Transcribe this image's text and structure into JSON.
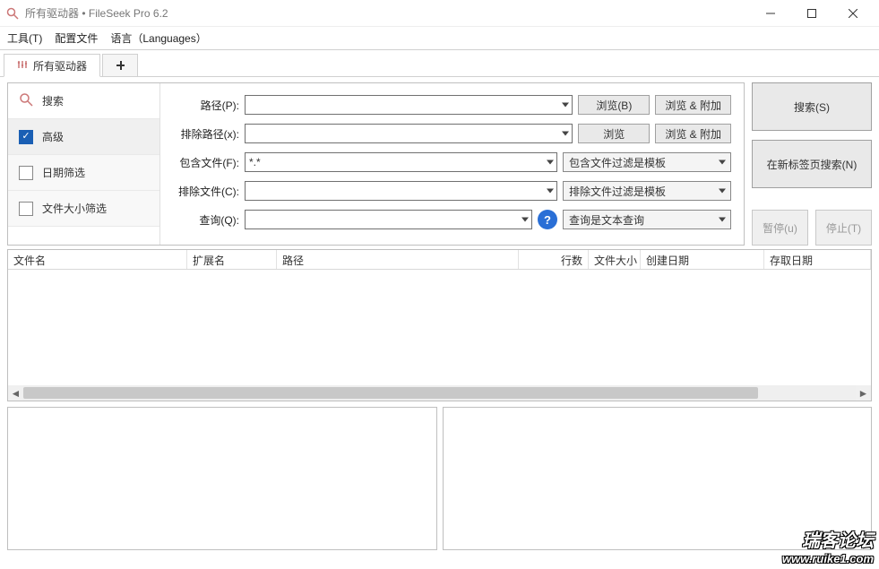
{
  "title": "所有驱动器 • FileSeek Pro 6.2",
  "menubar": {
    "tools": "工具(T)",
    "profiles": "配置文件",
    "language": "语言（Languages）"
  },
  "tabs": {
    "main": "所有驱动器"
  },
  "sidebar": {
    "search": "搜索",
    "advanced": "高级",
    "date_filter": "日期筛选",
    "size_filter": "文件大小筛选"
  },
  "form": {
    "path_label": "路径(P):",
    "exclude_path_label": "排除路径(x):",
    "include_file_label": "包含文件(F):",
    "include_file_value": "*.*",
    "exclude_file_label": "排除文件(C):",
    "query_label": "查询(Q):",
    "browse_b": "浏览(B)",
    "browse": "浏览",
    "browse_append": "浏览 & 附加",
    "include_filter_dd": "包含文件过滤是模板",
    "exclude_filter_dd": "排除文件过滤是模板",
    "query_type_dd": "查询是文本查询"
  },
  "right_buttons": {
    "search": "搜索(S)",
    "search_new_tab": "在新标签页搜索(N)",
    "pause": "暂停(u)",
    "stop": "停止(T)"
  },
  "table_headers": {
    "filename": "文件名",
    "ext": "扩展名",
    "path": "路径",
    "lines": "行数",
    "size": "文件大小",
    "created": "创建日期",
    "accessed": "存取日期"
  },
  "watermark": {
    "line1": "瑞客论坛",
    "line2": "www.ruike1.com"
  }
}
